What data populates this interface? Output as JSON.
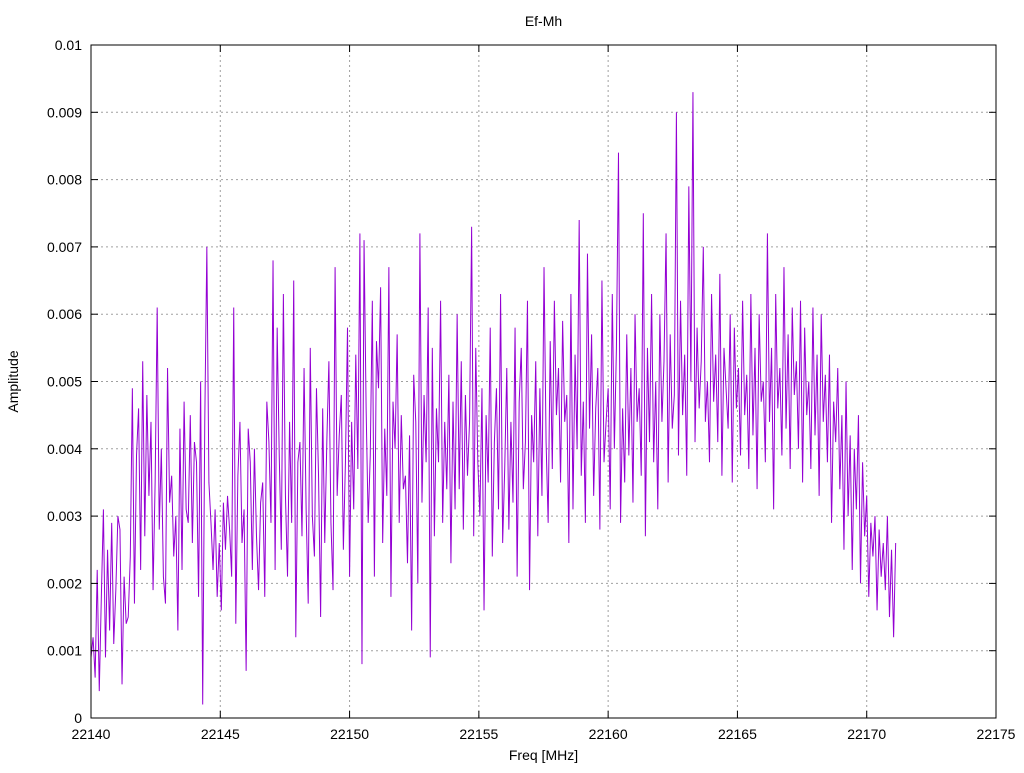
{
  "chart_data": {
    "type": "line",
    "title": "Ef-Mh",
    "xlabel": "Freq [MHz]",
    "ylabel": "Amplitude",
    "xlim": [
      22140,
      22175
    ],
    "ylim": [
      0,
      0.01
    ],
    "x_ticks": [
      "22140",
      "22145",
      "22150",
      "22155",
      "22160",
      "22165",
      "22170",
      "22175"
    ],
    "y_ticks": [
      "0",
      "0.001",
      "0.002",
      "0.003",
      "0.004",
      "0.005",
      "0.006",
      "0.007",
      "0.008",
      "0.009",
      "0.01"
    ],
    "grid": true,
    "line_color": "#9400d3",
    "x_start": 22140.0,
    "x_step": 0.08,
    "series": [
      {
        "values": [
          0.0009,
          0.0012,
          0.0006,
          0.0022,
          0.0004,
          0.0018,
          0.0031,
          0.0009,
          0.0025,
          0.0013,
          0.0029,
          0.0011,
          0.0019,
          0.003,
          0.0028,
          0.0005,
          0.0021,
          0.0014,
          0.0015,
          0.0024,
          0.0049,
          0.0017,
          0.0039,
          0.0046,
          0.0022,
          0.0053,
          0.0027,
          0.0048,
          0.0033,
          0.0044,
          0.0019,
          0.0035,
          0.0061,
          0.0028,
          0.004,
          0.0021,
          0.0017,
          0.0052,
          0.0032,
          0.0036,
          0.0024,
          0.003,
          0.0013,
          0.0043,
          0.0022,
          0.0047,
          0.0031,
          0.0029,
          0.0045,
          0.0026,
          0.0041,
          0.0038,
          0.0018,
          0.005,
          0.0002,
          0.0044,
          0.007,
          0.0035,
          0.0029,
          0.0022,
          0.0031,
          0.0018,
          0.0026,
          0.0016,
          0.0032,
          0.0025,
          0.0033,
          0.0028,
          0.0021,
          0.0061,
          0.0014,
          0.0036,
          0.0044,
          0.0026,
          0.0031,
          0.0007,
          0.0043,
          0.0038,
          0.0022,
          0.004,
          0.0027,
          0.0019,
          0.0032,
          0.0035,
          0.0018,
          0.0047,
          0.0041,
          0.0029,
          0.0068,
          0.0022,
          0.0058,
          0.0039,
          0.0025,
          0.0063,
          0.0033,
          0.0021,
          0.0044,
          0.0029,
          0.0065,
          0.0012,
          0.0038,
          0.0041,
          0.0027,
          0.0052,
          0.0031,
          0.0017,
          0.0055,
          0.003,
          0.0024,
          0.0049,
          0.0036,
          0.0015,
          0.0046,
          0.0026,
          0.0041,
          0.0053,
          0.0029,
          0.0019,
          0.0067,
          0.0033,
          0.0042,
          0.0048,
          0.0025,
          0.0038,
          0.0058,
          0.0021,
          0.0044,
          0.0031,
          0.0054,
          0.0037,
          0.0072,
          0.0008,
          0.0071,
          0.0046,
          0.0029,
          0.0039,
          0.0062,
          0.0021,
          0.0056,
          0.0049,
          0.0064,
          0.0026,
          0.0043,
          0.0033,
          0.0067,
          0.0018,
          0.0047,
          0.004,
          0.0057,
          0.0029,
          0.0045,
          0.0034,
          0.0036,
          0.0023,
          0.0042,
          0.0013,
          0.0051,
          0.0044,
          0.002,
          0.0072,
          0.0032,
          0.0048,
          0.0038,
          0.0061,
          0.0009,
          0.0055,
          0.0027,
          0.0046,
          0.0038,
          0.0062,
          0.0029,
          0.0044,
          0.0034,
          0.0051,
          0.0023,
          0.0047,
          0.0031,
          0.006,
          0.0034,
          0.0053,
          0.0028,
          0.0048,
          0.0036,
          0.0044,
          0.0073,
          0.0027,
          0.0055,
          0.0038,
          0.003,
          0.0049,
          0.0016,
          0.0045,
          0.0035,
          0.0058,
          0.0024,
          0.0041,
          0.0049,
          0.0031,
          0.0063,
          0.0026,
          0.0037,
          0.0052,
          0.0028,
          0.0044,
          0.0032,
          0.0058,
          0.0021,
          0.0047,
          0.0055,
          0.0034,
          0.0041,
          0.0062,
          0.0019,
          0.0045,
          0.0038,
          0.0053,
          0.0027,
          0.0049,
          0.0033,
          0.0067,
          0.0041,
          0.0029,
          0.0056,
          0.0037,
          0.0062,
          0.0045,
          0.0052,
          0.0035,
          0.0059,
          0.0044,
          0.0048,
          0.0026,
          0.0063,
          0.0031,
          0.0054,
          0.004,
          0.0074,
          0.0036,
          0.0047,
          0.0029,
          0.0069,
          0.0043,
          0.0057,
          0.0033,
          0.0046,
          0.0052,
          0.0028,
          0.0065,
          0.0038,
          0.0044,
          0.0049,
          0.0031,
          0.0063,
          0.004,
          0.0055,
          0.0084,
          0.0029,
          0.0046,
          0.0035,
          0.0057,
          0.0039,
          0.0052,
          0.0032,
          0.006,
          0.0044,
          0.0049,
          0.0036,
          0.0075,
          0.0027,
          0.0055,
          0.0041,
          0.0063,
          0.0038,
          0.005,
          0.0031,
          0.006,
          0.0044,
          0.0053,
          0.0072,
          0.0035,
          0.0057,
          0.0043,
          0.0048,
          0.009,
          0.0039,
          0.0062,
          0.0045,
          0.0054,
          0.0036,
          0.0079,
          0.005,
          0.0093,
          0.0041,
          0.0058,
          0.0046,
          0.0053,
          0.007,
          0.0044,
          0.005,
          0.0038,
          0.0063,
          0.0047,
          0.0054,
          0.0041,
          0.0066,
          0.0036,
          0.0055,
          0.0049,
          0.0043,
          0.006,
          0.0035,
          0.0058,
          0.0046,
          0.0052,
          0.0039,
          0.0062,
          0.0045,
          0.0051,
          0.0037,
          0.0063,
          0.0042,
          0.0055,
          0.0034,
          0.006,
          0.0047,
          0.005,
          0.0038,
          0.0072,
          0.0044,
          0.0055,
          0.0031,
          0.0063,
          0.0046,
          0.0052,
          0.0039,
          0.0067,
          0.0043,
          0.0057,
          0.0037,
          0.0061,
          0.0048,
          0.0053,
          0.004,
          0.0062,
          0.0035,
          0.0058,
          0.0045,
          0.005,
          0.0037,
          0.0061,
          0.0042,
          0.0054,
          0.0033,
          0.006,
          0.0044,
          0.0051,
          0.0038,
          0.0054,
          0.0029,
          0.0047,
          0.0041,
          0.0052,
          0.0034,
          0.0045,
          0.0025,
          0.005,
          0.003,
          0.0042,
          0.0022,
          0.004,
          0.0031,
          0.0045,
          0.002,
          0.0038,
          0.0027,
          0.0033,
          0.0018,
          0.0029,
          0.0024,
          0.003,
          0.0016,
          0.0028,
          0.0021,
          0.0026,
          0.0019,
          0.003,
          0.0015,
          0.0025,
          0.0012,
          0.0026
        ]
      }
    ]
  }
}
